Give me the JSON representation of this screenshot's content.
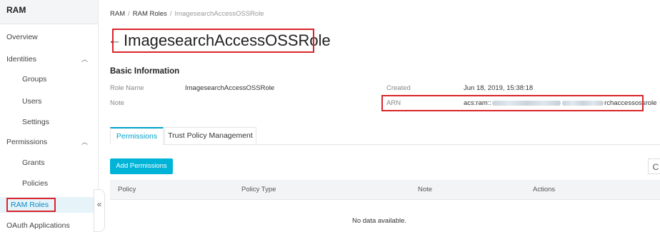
{
  "sidebar": {
    "title": "RAM",
    "items": {
      "overview": "Overview",
      "identities": "Identities",
      "groups": "Groups",
      "users": "Users",
      "settings": "Settings",
      "permissions": "Permissions",
      "grants": "Grants",
      "policies": "Policies",
      "ram_roles": "RAM Roles",
      "oauth_applications": "OAuth Applications"
    },
    "expanded_chevron": "︿",
    "collapse_glyph": "«"
  },
  "breadcrumb": {
    "root": "RAM",
    "parent": "RAM Roles",
    "current": "ImagesearchAccessOSSRole",
    "separator": "/"
  },
  "header": {
    "back_glyph": "←",
    "title": "ImagesearchAccessOSSRole"
  },
  "basic_info": {
    "section_title": "Basic Information",
    "role_name_label": "Role Name",
    "role_name_value": "ImagesearchAccessOSSRole",
    "note_label": "Note",
    "created_label": "Created",
    "created_value": "Jun 18, 2019, 15:38:18",
    "arn_label": "ARN",
    "arn_prefix": "acs:ram::",
    "arn_suffix": "rchaccessossrole"
  },
  "tabs": {
    "permissions": "Permissions",
    "trust_policy": "Trust Policy Management"
  },
  "toolbar": {
    "add_permissions": "Add Permissions",
    "refresh_glyph": "C"
  },
  "table": {
    "columns": {
      "policy": "Policy",
      "policy_type": "Policy Type",
      "note": "Note",
      "actions": "Actions"
    },
    "empty_text": "No data available."
  },
  "colors": {
    "accent": "#00a2ca",
    "button": "#00b4d8",
    "highlight_box": "#d9252b",
    "active_sidebar_bg": "#e6f4fa"
  }
}
